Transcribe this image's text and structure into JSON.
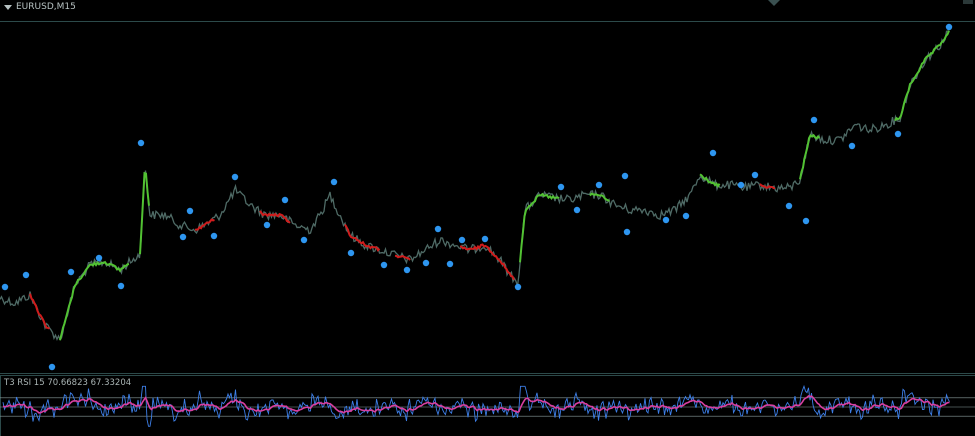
{
  "window": {
    "symbol_label": "EURUSD,M15"
  },
  "indicator": {
    "label": "T3 RSI 15 70.66823 67.33204"
  },
  "colors": {
    "background": "#000000",
    "frame": "#2c4a4a",
    "price_base": "#4f6b66",
    "up_segment": "#52c233",
    "down_segment": "#d01c1c",
    "marker": "#2e96f0",
    "rsi_blue": "#3d7fe8",
    "rsi_magenta": "#d83fa0",
    "rsi_levels": "#8a9b9b"
  },
  "chart_data": {
    "type": "line",
    "title": "EURUSD,M15",
    "x": [
      0,
      15,
      30,
      45,
      60,
      75,
      90,
      105,
      120,
      130,
      140,
      145,
      150,
      165,
      180,
      195,
      210,
      220,
      235,
      250,
      265,
      280,
      295,
      310,
      320,
      330,
      340,
      350,
      365,
      380,
      395,
      410,
      425,
      440,
      455,
      470,
      485,
      500,
      510,
      518,
      525,
      540,
      555,
      570,
      585,
      600,
      615,
      630,
      645,
      660,
      675,
      690,
      700,
      715,
      730,
      745,
      760,
      775,
      790,
      800,
      810,
      825,
      840,
      855,
      870,
      885,
      900,
      910,
      925,
      940,
      950
    ],
    "series": [
      {
        "values": [
          298,
          303,
          295,
          325,
          340,
          285,
          265,
          262,
          270,
          262,
          255,
          165,
          215,
          215,
          225,
          230,
          222,
          215,
          190,
          205,
          215,
          215,
          225,
          230,
          215,
          195,
          215,
          235,
          245,
          250,
          255,
          260,
          250,
          240,
          245,
          250,
          245,
          260,
          275,
          282,
          210,
          195,
          198,
          200,
          195,
          195,
          205,
          210,
          210,
          215,
          210,
          195,
          175,
          185,
          185,
          188,
          185,
          188,
          188,
          180,
          135,
          140,
          140,
          125,
          130,
          125,
          118,
          85,
          60,
          45,
          30
        ]
      }
    ],
    "segments_up": [
      [
        60,
        130
      ],
      [
        140,
        150
      ],
      [
        520,
        560
      ],
      [
        590,
        610
      ],
      [
        700,
        720
      ],
      [
        800,
        820
      ],
      [
        895,
        950
      ]
    ],
    "segments_down": [
      [
        30,
        50
      ],
      [
        195,
        215
      ],
      [
        260,
        290
      ],
      [
        345,
        380
      ],
      [
        395,
        410
      ],
      [
        460,
        515
      ],
      [
        760,
        775
      ]
    ],
    "markers_high": [
      [
        5,
        287
      ],
      [
        26,
        275
      ],
      [
        71,
        272
      ],
      [
        99,
        258
      ],
      [
        141,
        143
      ],
      [
        190,
        211
      ],
      [
        235,
        177
      ],
      [
        285,
        200
      ],
      [
        334,
        182
      ],
      [
        438,
        229
      ],
      [
        462,
        240
      ],
      [
        485,
        239
      ],
      [
        561,
        187
      ],
      [
        599,
        185
      ],
      [
        625,
        176
      ],
      [
        713,
        153
      ],
      [
        755,
        175
      ],
      [
        814,
        120
      ],
      [
        949,
        27
      ]
    ],
    "markers_low": [
      [
        52,
        367
      ],
      [
        121,
        286
      ],
      [
        183,
        237
      ],
      [
        214,
        236
      ],
      [
        267,
        225
      ],
      [
        304,
        240
      ],
      [
        351,
        253
      ],
      [
        384,
        265
      ],
      [
        407,
        270
      ],
      [
        426,
        263
      ],
      [
        450,
        264
      ],
      [
        518,
        287
      ],
      [
        577,
        210
      ],
      [
        627,
        232
      ],
      [
        666,
        220
      ],
      [
        686,
        216
      ],
      [
        741,
        185
      ],
      [
        789,
        206
      ],
      [
        806,
        221
      ],
      [
        852,
        146
      ],
      [
        898,
        134
      ]
    ],
    "rsi_levels": [
      70,
      50,
      30
    ],
    "rsi_range": [
      0,
      100
    ]
  }
}
